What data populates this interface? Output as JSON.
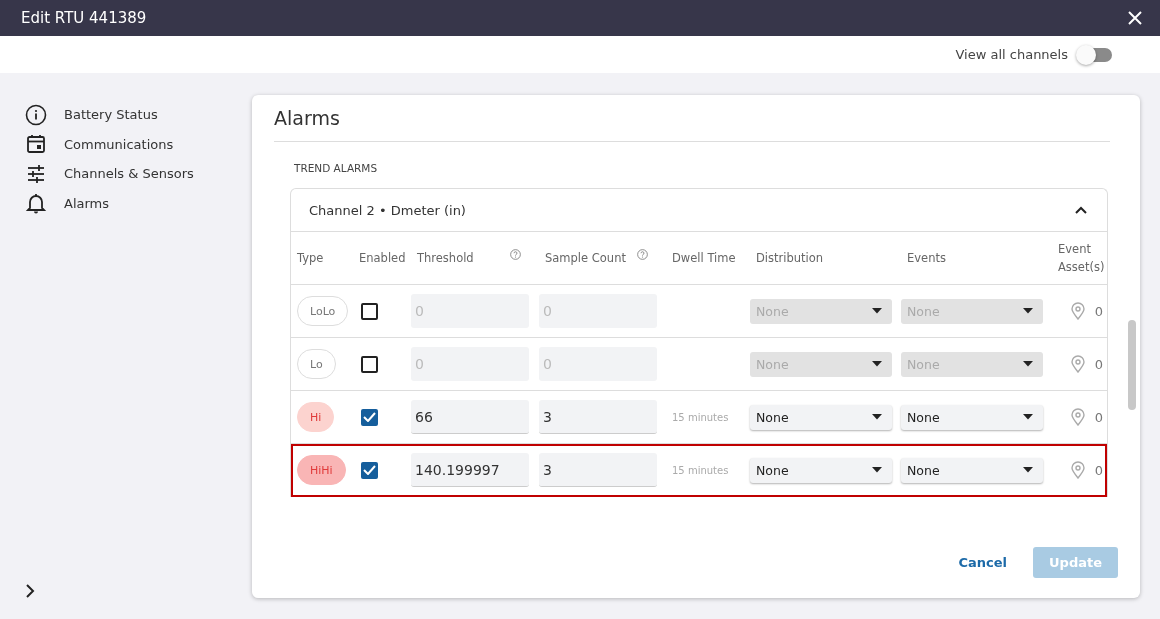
{
  "window": {
    "title": "Edit RTU 441389"
  },
  "view_all_channels": {
    "label": "View all channels",
    "on": false
  },
  "sidebar": {
    "items": [
      {
        "kind": "info",
        "label": "Battery Status"
      },
      {
        "kind": "calendar",
        "label": "Communications"
      },
      {
        "kind": "sliders",
        "label": "Channels & Sensors"
      },
      {
        "kind": "bell",
        "label": "Alarms"
      }
    ]
  },
  "panel": {
    "title": "Alarms",
    "section": "TREND ALARMS",
    "channel": {
      "title": "Channel 2 • Dmeter (in)",
      "expanded": true
    },
    "columns": [
      {
        "label": "Type",
        "help": false
      },
      {
        "label": "Enabled",
        "help": false
      },
      {
        "label": "Threshold",
        "help": true
      },
      {
        "label": "Sample Count",
        "help": true
      },
      {
        "label": "Dwell Time",
        "help": false
      },
      {
        "label": "Distribution",
        "help": false
      },
      {
        "label": "Events",
        "help": false
      },
      {
        "label": "Event Asset(s)",
        "help": false
      }
    ],
    "rows": [
      {
        "type": "LoLo",
        "color": "#ffffff",
        "enabled": false,
        "threshold": "0",
        "sample_count": "0",
        "distribution": "None",
        "events": "None",
        "assets": "0",
        "highlighted": false
      },
      {
        "type": "Lo",
        "color": "#ffffff",
        "enabled": false,
        "threshold": "0",
        "sample_count": "0",
        "distribution": "None",
        "events": "None",
        "assets": "0",
        "highlighted": false
      },
      {
        "type": "Hi",
        "color": "#fcd3cf",
        "enabled": true,
        "threshold": "66",
        "sample_count": "3",
        "dwell_time": "15 minutes",
        "distribution": "None",
        "events": "None",
        "assets": "0",
        "highlighted": false
      },
      {
        "type": "HiHi",
        "color": "#f9b5b5",
        "enabled": true,
        "threshold": "140.199997",
        "sample_count": "3",
        "dwell_time": "15 minutes",
        "distribution": "None",
        "events": "None",
        "assets": "0",
        "highlighted": true
      }
    ]
  },
  "buttons": [
    {
      "kind": "link",
      "label": "Cancel"
    },
    {
      "kind": "primary",
      "label": "Update",
      "disabled": true
    }
  ]
}
